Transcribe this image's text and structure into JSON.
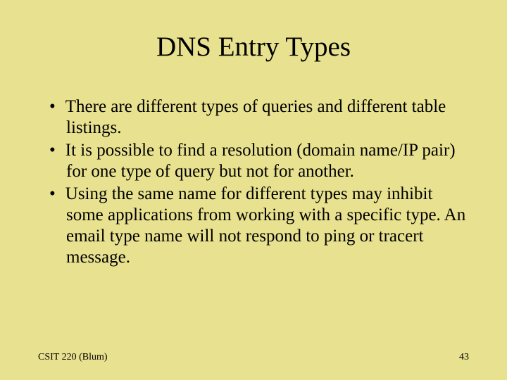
{
  "slide": {
    "title": "DNS Entry Types",
    "bullets": [
      "There are different types of queries and different table listings.",
      "It is possible to find a resolution (domain name/IP pair) for one type of query but not for another.",
      "Using the same name for different types may inhibit some applications from working with a specific type. An email type name will not respond to ping or tracert message."
    ],
    "footer_left": "CSIT 220 (Blum)",
    "footer_right": "43"
  }
}
